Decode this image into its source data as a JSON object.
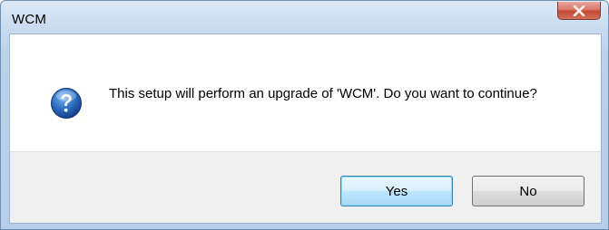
{
  "window": {
    "title": "WCM"
  },
  "dialog": {
    "icon": "question-icon",
    "message": "This setup will perform an upgrade of 'WCM'. Do you want to continue?"
  },
  "buttons": {
    "yes_label": "Yes",
    "no_label": "No"
  },
  "colors": {
    "titlebar": "#c9dbef",
    "close_button": "#c44a34",
    "default_button": "#bee6fd",
    "icon": "#1f5fb0"
  }
}
